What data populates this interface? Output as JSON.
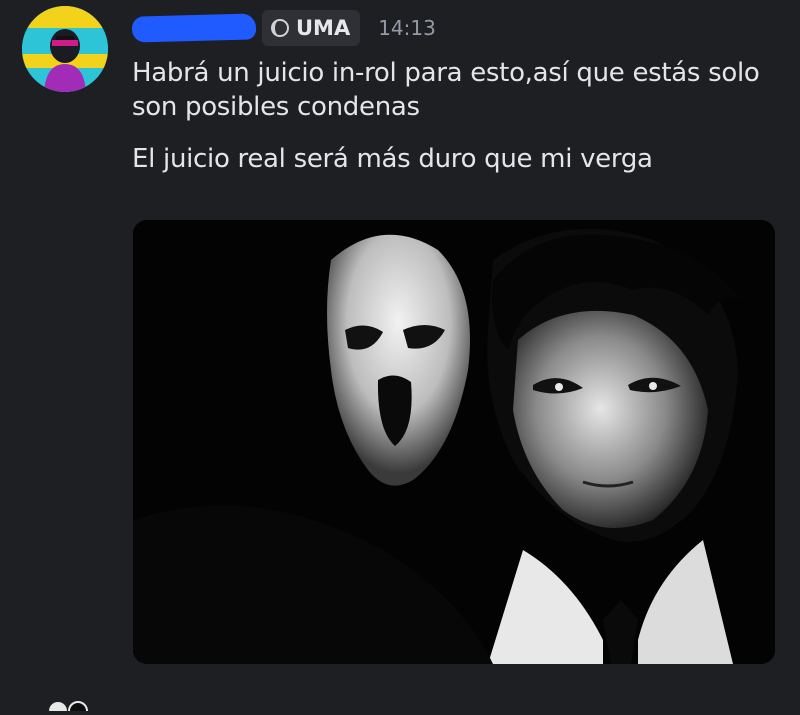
{
  "message": {
    "avatar_icon": "user-avatar",
    "username_redacted": true,
    "tag": {
      "label": "UMA",
      "icon": "moon-icon"
    },
    "timestamp": "14:13",
    "lines": [
      "Habrá un juicio in-rol para esto,así que estás solo son posibles condenas",
      "El juicio real será más duro que mi verga"
    ],
    "attachment": {
      "kind": "image",
      "icon": "image-attachment"
    }
  },
  "colors": {
    "background": "#1e1f23",
    "text": "#e3e5e8",
    "muted": "#949ba4",
    "tag_bg": "#2e3035",
    "redaction": "#1f5bff"
  }
}
